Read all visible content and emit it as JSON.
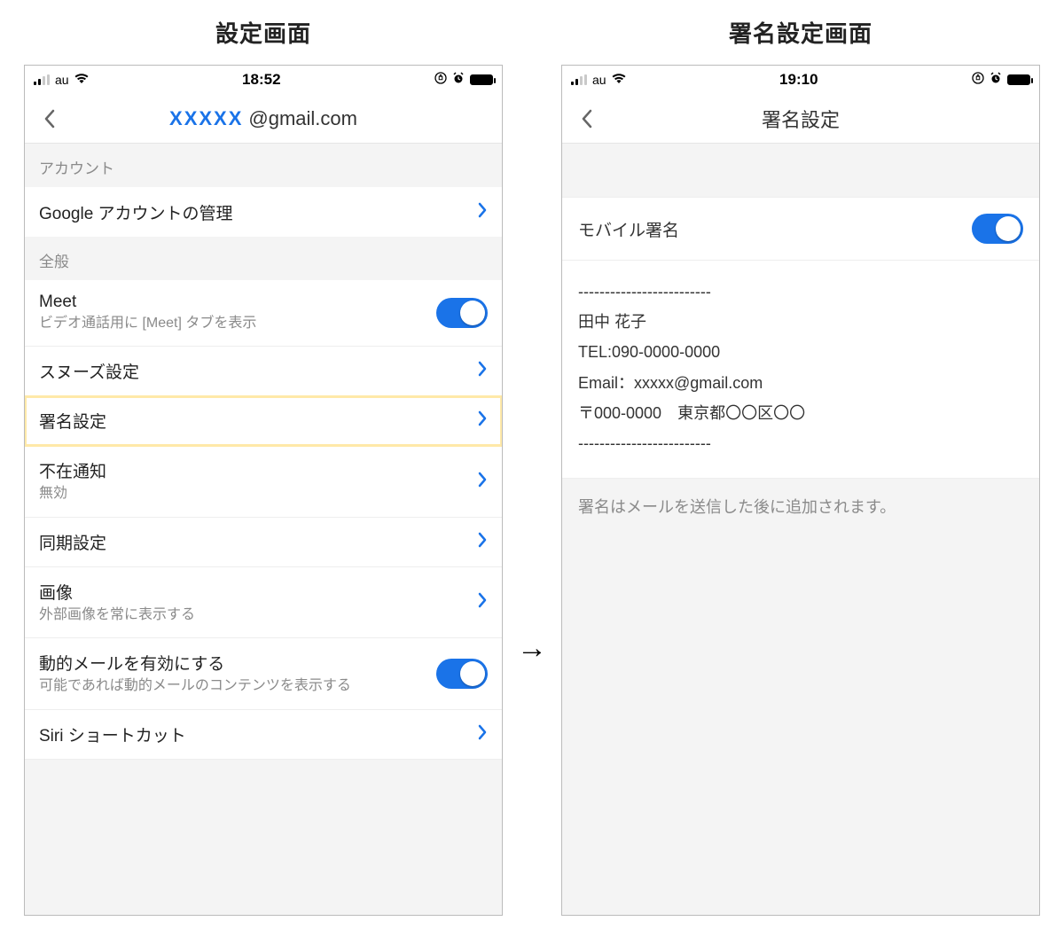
{
  "left": {
    "screen_title": "設定画面",
    "status": {
      "carrier": "au",
      "time": "18:52"
    },
    "nav": {
      "title_masked": "XXXXX",
      "title_domain": "@gmail.com"
    },
    "sections": {
      "account_header": "アカウント",
      "general_header": "全般"
    },
    "rows": {
      "manage": "Google アカウントの管理",
      "meet_primary": "Meet",
      "meet_secondary": "ビデオ通話用に [Meet] タブを表示",
      "snooze": "スヌーズ設定",
      "signature": "署名設定",
      "vacation_primary": "不在通知",
      "vacation_secondary": "無効",
      "sync": "同期設定",
      "images_primary": "画像",
      "images_secondary": "外部画像を常に表示する",
      "dynamic_primary": "動的メールを有効にする",
      "dynamic_secondary": "可能であれば動的メールのコンテンツを表示する",
      "siri": "Siri ショートカット"
    }
  },
  "right": {
    "screen_title": "署名設定画面",
    "status": {
      "carrier": "au",
      "time": "19:10"
    },
    "nav_title": "署名設定",
    "toggle_label": "モバイル署名",
    "signature_lines": [
      "-------------------------",
      "田中 花子",
      "TEL:090-0000-0000",
      "Email：xxxxx@gmail.com",
      "〒000-0000　東京都〇〇区〇〇",
      "-------------------------"
    ],
    "note": "署名はメールを送信した後に追加されます。"
  }
}
